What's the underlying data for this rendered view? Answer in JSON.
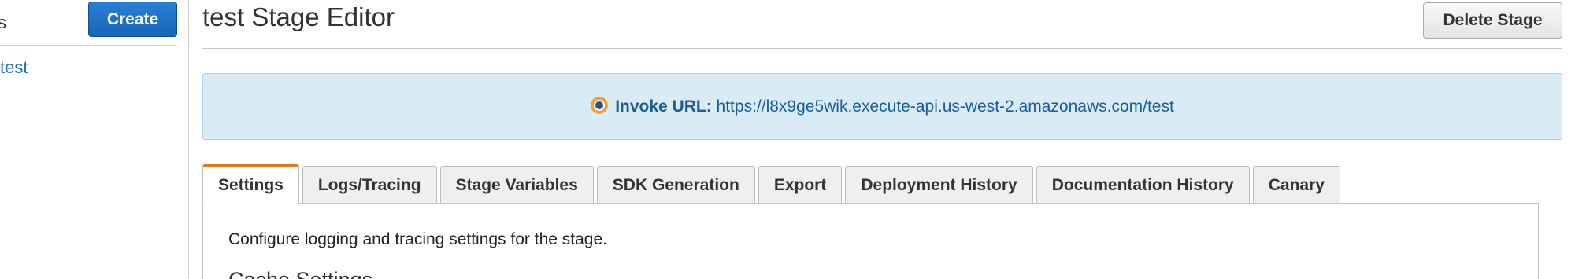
{
  "left_panel": {
    "header_fragment": "s",
    "create_label": "Create",
    "stage_link": "test"
  },
  "header": {
    "title": "test Stage Editor",
    "delete_label": "Delete Stage"
  },
  "invoke": {
    "icon": "target-icon",
    "label": "Invoke URL:",
    "url": "https://l8x9ge5wik.execute-api.us-west-2.amazonaws.com/test"
  },
  "tabs": [
    {
      "label": "Settings",
      "active": true
    },
    {
      "label": "Logs/Tracing",
      "active": false
    },
    {
      "label": "Stage Variables",
      "active": false
    },
    {
      "label": "SDK Generation",
      "active": false
    },
    {
      "label": "Export",
      "active": false
    },
    {
      "label": "Deployment History",
      "active": false
    },
    {
      "label": "Documentation History",
      "active": false
    },
    {
      "label": "Canary",
      "active": false
    }
  ],
  "panel": {
    "description": "Configure logging and tracing settings for the stage.",
    "section_heading": "Cache Settings"
  },
  "colors": {
    "primary_button": "#1666ba",
    "link": "#1d6fc4",
    "banner_bg": "#d9ecf5",
    "active_tab_accent": "#e07b1c"
  }
}
